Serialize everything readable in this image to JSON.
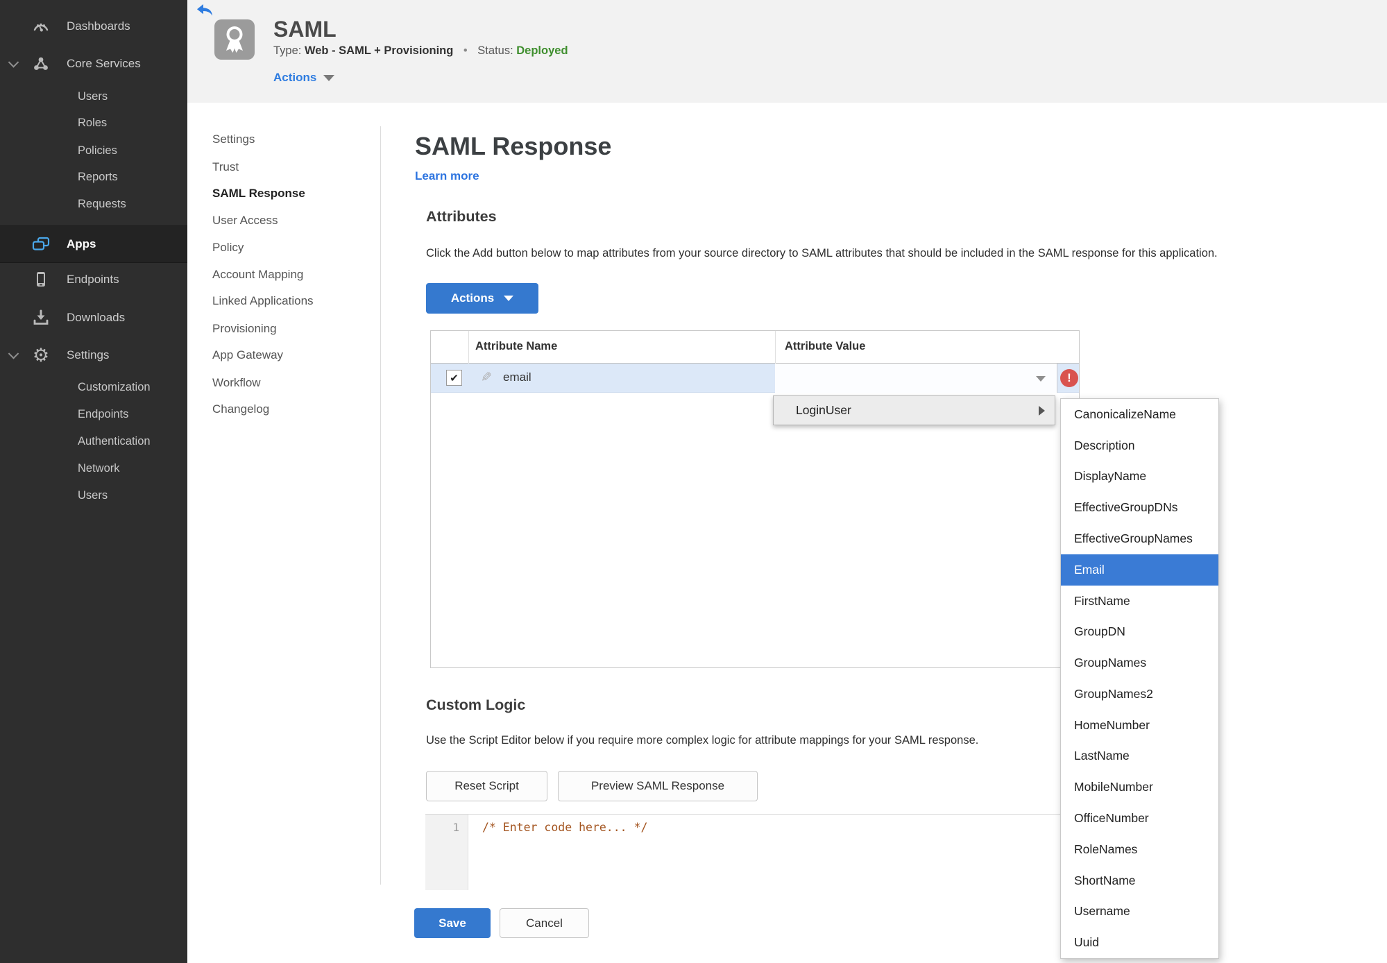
{
  "colors": {
    "accent_blue": "#3579cf",
    "link_blue": "#2e75e0",
    "status_green": "#3e8e2d",
    "error_red": "#d9534f",
    "row_highlight": "#dce8f8",
    "selected_menu_blue": "#3a7bd5",
    "sidebar_bg": "#2e2e2e"
  },
  "icons": {
    "check": "✔",
    "pencil": "✎",
    "gear": "⚙",
    "error": "!"
  },
  "sidebar": {
    "items": [
      "Dashboards",
      "Core Services",
      "Users",
      "Roles",
      "Policies",
      "Reports",
      "Requests",
      "Apps",
      "Endpoints",
      "Downloads",
      "Settings",
      "Customization",
      "Endpoints",
      "Authentication",
      "Network",
      "Users"
    ]
  },
  "header": {
    "app_name": "SAML",
    "type_label": "Type:",
    "type_value": "Web - SAML + Provisioning",
    "separator": "•",
    "status_label": "Status:",
    "status_value": "Deployed",
    "actions_label": "Actions"
  },
  "subnav": {
    "items": [
      "Settings",
      "Trust",
      "SAML Response",
      "User Access",
      "Policy",
      "Account Mapping",
      "Linked Applications",
      "Provisioning",
      "App Gateway",
      "Workflow",
      "Changelog"
    ],
    "active": "SAML Response"
  },
  "main": {
    "title": "SAML Response",
    "learn_more": "Learn more",
    "attributes": {
      "heading": "Attributes",
      "description": "Click the Add button below to map attributes from your source directory to SAML attributes that should be included in the SAML response for this application.",
      "actions_button": "Actions",
      "table": {
        "columns": [
          "Attribute Name",
          "Attribute Value"
        ],
        "row": {
          "name": "email",
          "value": "",
          "checked": true,
          "error": true
        }
      }
    },
    "custom_logic": {
      "heading": "Custom Logic",
      "description": "Use the Script Editor below if you require more complex logic for attribute mappings for your SAML response.",
      "reset_button": "Reset Script",
      "preview_button": "Preview SAML Response",
      "editor": {
        "line_number": "1",
        "code": "/* Enter code here... */"
      }
    },
    "save_button": "Save",
    "cancel_button": "Cancel"
  },
  "dropdown": {
    "menu_item": "LoginUser",
    "selected": "Email",
    "submenu": [
      "CanonicalizeName",
      "Description",
      "DisplayName",
      "EffectiveGroupDNs",
      "EffectiveGroupNames",
      "Email",
      "FirstName",
      "GroupDN",
      "GroupNames",
      "GroupNames2",
      "HomeNumber",
      "LastName",
      "MobileNumber",
      "OfficeNumber",
      "RoleNames",
      "ShortName",
      "Username",
      "Uuid"
    ]
  }
}
